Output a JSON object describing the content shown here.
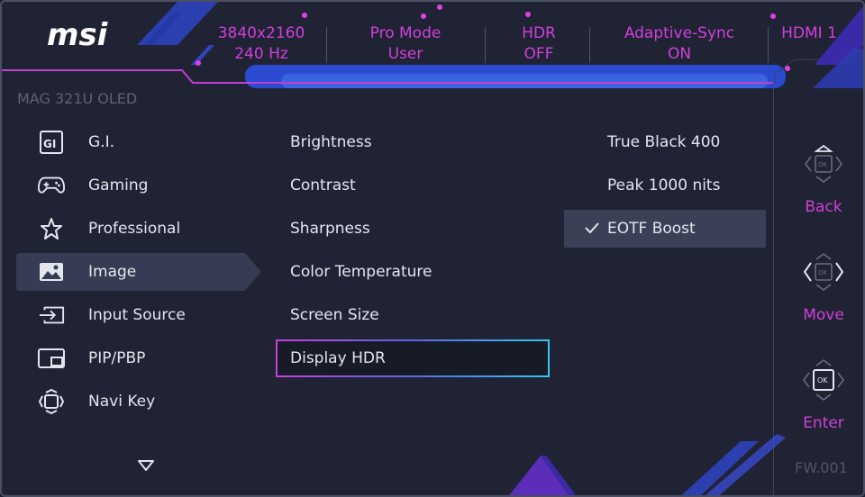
{
  "header": {
    "brand": "msi",
    "resolution": "3840x2160",
    "refresh_rate": "240 Hz",
    "mode_title": "Pro Mode",
    "mode_value": "User",
    "hdr_title": "HDR",
    "hdr_value": "OFF",
    "sync_title": "Adaptive-Sync",
    "sync_value": "ON",
    "input": "HDMI 1"
  },
  "model": "MAG 321U OLED",
  "menu": {
    "items": [
      {
        "label": "G.I.",
        "icon": "gi-icon"
      },
      {
        "label": "Gaming",
        "icon": "gamepad-icon"
      },
      {
        "label": "Professional",
        "icon": "star-icon"
      },
      {
        "label": "Image",
        "icon": "image-icon"
      },
      {
        "label": "Input Source",
        "icon": "input-source-icon"
      },
      {
        "label": "PIP/PBP",
        "icon": "pip-icon"
      },
      {
        "label": "Navi Key",
        "icon": "navi-key-icon"
      }
    ],
    "selected": "Image"
  },
  "submenu": {
    "items": [
      "Brightness",
      "Contrast",
      "Sharpness",
      "Color Temperature",
      "Screen Size",
      "Display HDR"
    ],
    "focused": "Display HDR"
  },
  "options": {
    "items": [
      "True Black 400",
      "Peak 1000 nits",
      "EOTF Boost"
    ],
    "selected": "EOTF Boost"
  },
  "nav": {
    "back": "Back",
    "move": "Move",
    "enter": "Enter",
    "ok_glyph": "OK"
  },
  "firmware": "FW.001",
  "colors": {
    "accent_magenta": "#d23fdc",
    "accent_cyan": "#39c4ef",
    "background": "#1f2333",
    "selected_bg": "#363c53"
  }
}
